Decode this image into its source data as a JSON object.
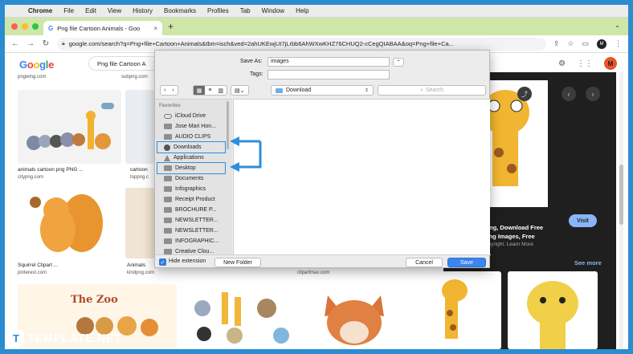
{
  "menubar": {
    "app": "Chrome",
    "items": [
      "File",
      "Edit",
      "View",
      "History",
      "Bookmarks",
      "Profiles",
      "Tab",
      "Window",
      "Help"
    ]
  },
  "tab": {
    "title": "Png file Cartoon Animals - Goo",
    "close": "×",
    "new": "+"
  },
  "address": {
    "url": "google.com/search?q=Png+file+Cartoon+Animals&tbm=isch&ved=2ahUKEwjUI7jLrbb6AhWXwKHZ76CHUQ2-cCegQIABAA&oq=Png+file+Ca..."
  },
  "google": {
    "logo": "Google",
    "search_value": "Png file Cartoon A",
    "avatar": "M"
  },
  "results": {
    "row0_sources": [
      "pngwing.com",
      "subpng.com"
    ],
    "row1": [
      {
        "caption": "animals cartoon png PNG ...",
        "source": "citypng.com"
      },
      {
        "caption": "cartoon",
        "source": "toppng.c"
      }
    ],
    "row2": [
      {
        "caption": "Squirrel Clipart ...",
        "source": "pinterest.com"
      },
      {
        "caption": "Animals",
        "source": "kindpng.com"
      },
      {
        "caption": "",
        "source": "clipartmax.com"
      }
    ],
    "zoo_text": "The Zoo"
  },
  "panel": {
    "title": "Png, Download Free\nong Images, Free",
    "note": "opyright. Learn More",
    "visit": "Visit",
    "more": "See more"
  },
  "dialog": {
    "save_as_label": "Save As:",
    "save_as_value": "images",
    "tags_label": "Tags:",
    "tags_value": "",
    "location": "Download",
    "search_placeholder": "Search",
    "favorites": "Favorites",
    "sidebar_items": [
      {
        "label": "iCloud Drive",
        "icon": "cloud-icon"
      },
      {
        "label": "Jose Mari Hon...",
        "icon": "folder-icon"
      },
      {
        "label": "AUDIO CLIPS",
        "icon": "folder-icon"
      },
      {
        "label": "Downloads",
        "icon": "download-icon"
      },
      {
        "label": "Applications",
        "icon": "applications-icon"
      },
      {
        "label": "Desktop",
        "icon": "folder-icon"
      },
      {
        "label": "Documents",
        "icon": "folder-icon"
      },
      {
        "label": "Infographics",
        "icon": "folder-icon"
      },
      {
        "label": "Receipt Product",
        "icon": "folder-icon"
      },
      {
        "label": "BROCHURE P...",
        "icon": "folder-icon"
      },
      {
        "label": "NEWSLETTER...",
        "icon": "folder-icon"
      },
      {
        "label": "NEWSLETTER...",
        "icon": "folder-icon"
      },
      {
        "label": "INFOGRAPHIC...",
        "icon": "folder-icon"
      },
      {
        "label": "Creative Clou...",
        "icon": "folder-icon"
      }
    ],
    "hide_extension": "Hide extension",
    "new_folder": "New Folder",
    "cancel": "Cancel",
    "save": "Save"
  },
  "brand": {
    "name": "TEMPLATE.NET",
    "letter": "T"
  },
  "colors": {
    "frame": "#2b8cd0",
    "tabstrip": "#cfe6a9",
    "highlight": "#2f8ed9",
    "save": "#3a85f0"
  }
}
